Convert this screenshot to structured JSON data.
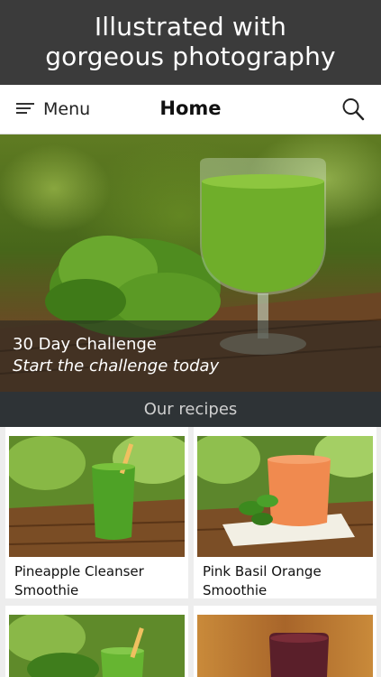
{
  "promo": {
    "line1": "Illustrated with",
    "line2": "gorgeous photography"
  },
  "navbar": {
    "menu_label": "Menu",
    "title": "Home",
    "menu_icon": "hamburger-menu-icon",
    "search_icon": "search-icon"
  },
  "hero": {
    "title": "30 Day Challenge",
    "subtitle": "Start the challenge today"
  },
  "section": {
    "title": "Our recipes"
  },
  "recipes": [
    {
      "name": "Pineapple Cleanser Smoothie"
    },
    {
      "name": "Pink Basil Orange Smoothie"
    },
    {
      "name": ""
    },
    {
      "name": ""
    }
  ],
  "colors": {
    "promo_bg": "#3b3b3b",
    "section_bar_bg": "#2e3336",
    "grid_bg": "#ededed",
    "smoothie_green": "#5aa82a",
    "smoothie_orange": "#f08a4f",
    "smoothie_berry": "#5a1f2a"
  }
}
